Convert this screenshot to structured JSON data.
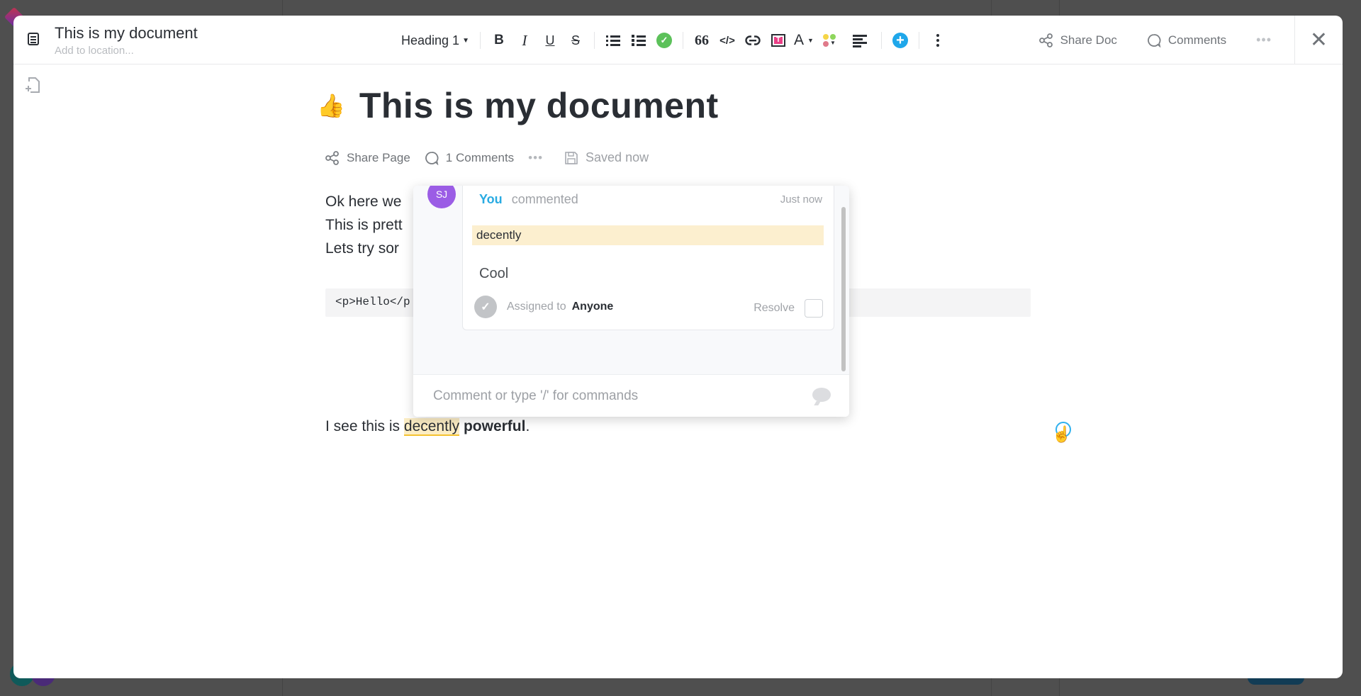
{
  "header": {
    "doc_icon": "document-icon",
    "title": "This is my document",
    "location_placeholder": "Add to location..."
  },
  "toolbar": {
    "heading_select": "Heading 1",
    "bold": "B",
    "italic": "I",
    "underline": "U",
    "strikethrough": "S",
    "blockquote": "66",
    "code": "</>",
    "link": "⊂⊃",
    "textbox": "T",
    "text_color": "A",
    "icons": [
      "bullet-list-icon",
      "numbered-list-icon",
      "checklist-icon",
      "quote-icon",
      "code-icon",
      "link-icon",
      "textbox-icon",
      "text-color-icon",
      "highlight-color-icon",
      "align-left-icon",
      "insert-plus-icon",
      "more-vertical-icon"
    ],
    "colors": {
      "checklist": "#5cc15a",
      "insert": "#1fa7ea",
      "textbox": "#ea3f87",
      "dot_yellow": "#f5d547",
      "dot_green": "#8ed65c",
      "dot_red": "#e07a8a"
    }
  },
  "top_right": {
    "share_doc": "Share Doc",
    "comments": "Comments",
    "more": "•••",
    "close": "✕"
  },
  "document": {
    "emoji": "👍",
    "title": "This is my document",
    "meta": {
      "share_page": "Share Page",
      "comments": "1 Comments",
      "more": "•••",
      "saved": "Saved now"
    },
    "lines": [
      "Ok here we",
      "This is prett",
      "Lets try sor"
    ],
    "code": "<p>Hello</p",
    "final_line": {
      "prefix": "I see this is ",
      "highlight": "decently",
      "space": " ",
      "bold": "powerful",
      "suffix": "."
    }
  },
  "comment_popover": {
    "avatar_initials": "SJ",
    "avatar_color": "#9b5de5",
    "author": "You",
    "verb": "commented",
    "time": "Just now",
    "quote": "decently",
    "body": "Cool",
    "assigned_label": "Assigned to",
    "assignee": "Anyone",
    "resolve_label": "Resolve",
    "input_placeholder": "Comment or type '/' for commands"
  }
}
